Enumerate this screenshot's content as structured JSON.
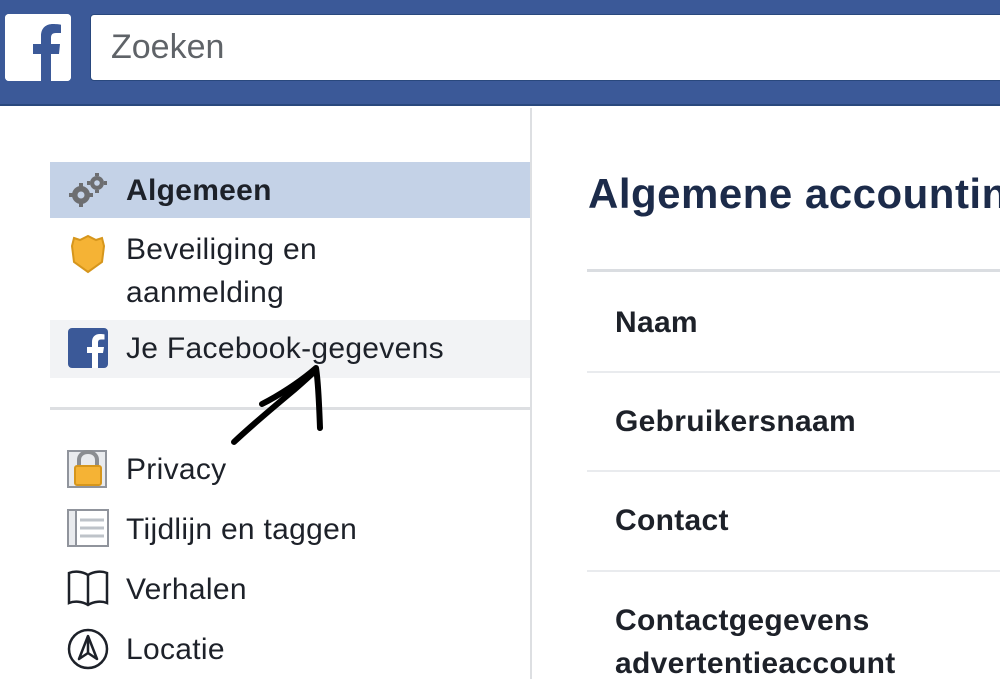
{
  "topbar": {
    "logo_icon": "facebook-f-icon",
    "search_placeholder": "Zoeken"
  },
  "sidebar": {
    "items": [
      {
        "label": "Algemeen",
        "icon": "gears-icon",
        "state": "active"
      },
      {
        "label": "Beveiliging en",
        "label_line2": "aanmelding",
        "icon": "police-badge-icon"
      },
      {
        "label": "Je Facebook-gegevens",
        "icon": "facebook-square-icon",
        "state": "hover"
      },
      {
        "label": "Privacy",
        "icon": "padlock-icon"
      },
      {
        "label": "Tijdlijn en taggen",
        "icon": "timeline-icon"
      },
      {
        "label": "Verhalen",
        "icon": "book-icon"
      },
      {
        "label": "Locatie",
        "icon": "location-compass-icon"
      }
    ]
  },
  "main": {
    "title": "Algemene accountin",
    "rows": [
      {
        "label": "Naam"
      },
      {
        "label": "Gebruikersnaam"
      },
      {
        "label": "Contact"
      },
      {
        "label": "Contactgegevens",
        "label_line2": "advertentieaccount"
      }
    ]
  },
  "colors": {
    "brand_blue": "#3b5998",
    "active_bg": "#c4d2e7",
    "title_color": "#1c2b4a"
  }
}
